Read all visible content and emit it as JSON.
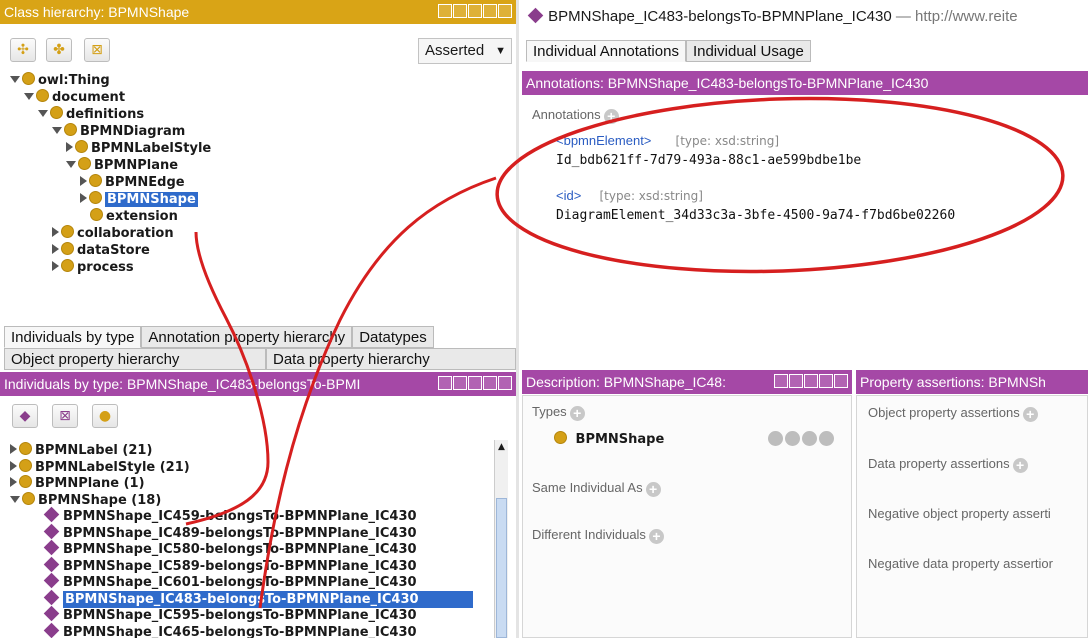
{
  "class_hierarchy": {
    "title": "Class hierarchy: BPMNShape",
    "dropdown_value": "Asserted",
    "tree": [
      {
        "label": "owl:Thing",
        "depth": 0,
        "expander": "open"
      },
      {
        "label": "document",
        "depth": 1,
        "expander": "open"
      },
      {
        "label": "definitions",
        "depth": 2,
        "expander": "open"
      },
      {
        "label": "BPMNDiagram",
        "depth": 3,
        "expander": "open"
      },
      {
        "label": "BPMNLabelStyle",
        "depth": 4,
        "expander": "closed"
      },
      {
        "label": "BPMNPlane",
        "depth": 4,
        "expander": "open"
      },
      {
        "label": "BPMNEdge",
        "depth": 5,
        "expander": "closed"
      },
      {
        "label": "BPMNShape",
        "depth": 5,
        "expander": "closed",
        "selected": true
      },
      {
        "label": "extension",
        "depth": 5,
        "expander": "none"
      },
      {
        "label": "collaboration",
        "depth": 3,
        "expander": "closed"
      },
      {
        "label": "dataStore",
        "depth": 3,
        "expander": "closed"
      },
      {
        "label": "process",
        "depth": 3,
        "expander": "closed"
      }
    ]
  },
  "lower_tabs": {
    "row1": [
      "Individuals by type",
      "Annotation property hierarchy",
      "Datatypes"
    ],
    "row2": [
      "Object property hierarchy",
      "Data property hierarchy"
    ]
  },
  "individuals": {
    "title": "Individuals by type: BPMNShape_IC483-belongsTo-BPMI",
    "tree": [
      {
        "label": "BPMNLabel (21)",
        "kind": "class",
        "expander": "closed"
      },
      {
        "label": "BPMNLabelStyle (21)",
        "kind": "class",
        "expander": "closed"
      },
      {
        "label": "BPMNPlane (1)",
        "kind": "class",
        "expander": "closed"
      },
      {
        "label": "BPMNShape (18)",
        "kind": "class",
        "expander": "open"
      },
      {
        "label": "BPMNShape_IC459-belongsTo-BPMNPlane_IC430",
        "kind": "individual"
      },
      {
        "label": "BPMNShape_IC489-belongsTo-BPMNPlane_IC430",
        "kind": "individual"
      },
      {
        "label": "BPMNShape_IC580-belongsTo-BPMNPlane_IC430",
        "kind": "individual"
      },
      {
        "label": "BPMNShape_IC589-belongsTo-BPMNPlane_IC430",
        "kind": "individual"
      },
      {
        "label": "BPMNShape_IC601-belongsTo-BPMNPlane_IC430",
        "kind": "individual"
      },
      {
        "label": "BPMNShape_IC483-belongsTo-BPMNPlane_IC430",
        "kind": "individual",
        "selected": true
      },
      {
        "label": "BPMNShape_IC595-belongsTo-BPMNPlane_IC430",
        "kind": "individual"
      },
      {
        "label": "BPMNShape_IC465-belongsTo-BPMNPlane_IC430",
        "kind": "individual"
      }
    ]
  },
  "entity_header": {
    "name": "BPMNShape_IC483-belongsTo-BPMNPlane_IC430",
    "separator": "—",
    "iri": "http://www.reite"
  },
  "annotations_panel": {
    "tabs": [
      "Individual Annotations",
      "Individual Usage"
    ],
    "title": "Annotations: BPMNShape_IC483-belongsTo-BPMNPlane_IC430",
    "section_label": "Annotations",
    "items": [
      {
        "property": "<bpmnElement>",
        "type": "[type: xsd:string]",
        "value": "Id_bdb621ff-7d79-493a-88c1-ae599bdbe1be"
      },
      {
        "property": "<id>",
        "type": "[type: xsd:string]",
        "value": "DiagramElement_34d33c3a-3bfe-4500-9a74-f7bd6be02260"
      }
    ]
  },
  "description_panel": {
    "title": "Description: BPMNShape_IC48:",
    "types_label": "Types",
    "type_value": "BPMNShape",
    "same_label": "Same Individual As",
    "different_label": "Different Individuals"
  },
  "property_panel": {
    "title": "Property assertions: BPMNSh",
    "object_label": "Object property assertions",
    "data_label": "Data property assertions",
    "neg_object_label": "Negative object property asserti",
    "neg_data_label": "Negative data property assertior"
  },
  "colors": {
    "gold_title": "#d9a416",
    "purple_title": "#a548a6",
    "selection": "#2f6bcb",
    "annotation_circle": "#d61f1f"
  }
}
